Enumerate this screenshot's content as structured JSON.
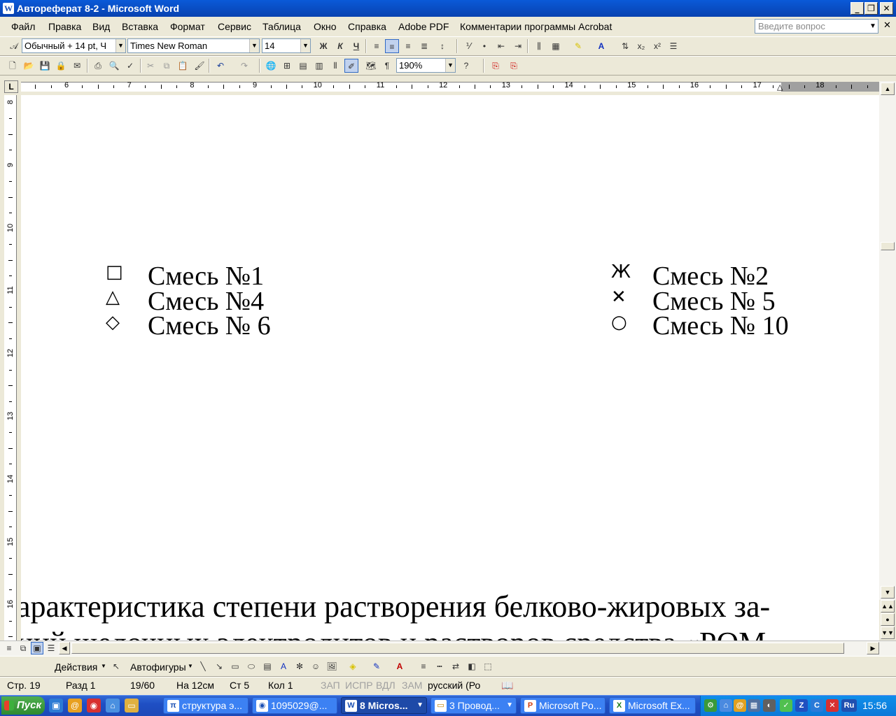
{
  "window": {
    "title": "Автореферат 8-2 - Microsoft Word",
    "app_icon": "W",
    "buttons": [
      "_",
      "❐",
      "✕"
    ]
  },
  "menu": {
    "items": [
      "Файл",
      "Правка",
      "Вид",
      "Вставка",
      "Формат",
      "Сервис",
      "Таблица",
      "Окно",
      "Справка",
      "Adobe PDF",
      "Комментарии программы Acrobat"
    ],
    "question_placeholder": "Введите вопрос"
  },
  "format_toolbar": {
    "style": "Обычный + 14 pt, Ч",
    "font": "Times New Roman",
    "size": "14",
    "bold": "Ж",
    "italic": "К",
    "underline": "Ч"
  },
  "standard_toolbar": {
    "zoom": "190%"
  },
  "ruler": {
    "h_numbers": [
      "6",
      "7",
      "8",
      "9",
      "10",
      "11",
      "12",
      "13",
      "14",
      "15",
      "16",
      "17",
      "18"
    ],
    "v_numbers": [
      "8",
      "9",
      "10",
      "11",
      "12",
      "13",
      "14",
      "15",
      "16"
    ]
  },
  "document": {
    "legend_left": [
      {
        "symbol": "□",
        "label": "Смесь №1"
      },
      {
        "symbol": "△",
        "label": "Смесь №4"
      },
      {
        "symbol": "◇",
        "label": "Смесь № 6"
      }
    ],
    "legend_right": [
      {
        "symbol": "Ж",
        "label": "Смесь №2"
      },
      {
        "symbol": "✕",
        "label": "Смесь № 5"
      },
      {
        "symbol": "○",
        "label": "Смесь № 10"
      }
    ],
    "line1": "арактеристика степени растворения белково-жировых за-",
    "line2": "ний щелочных электролитов и растворов средства «POM"
  },
  "draw_toolbar": {
    "actions": "Действия",
    "autoshapes": "Автофигуры"
  },
  "status": {
    "page": "Стр. 19",
    "section": "Разд 1",
    "pages": "19/60",
    "at": "На 12см",
    "line": "Ст 5",
    "col": "Кол 1",
    "rec": "ЗАП",
    "trk": "ИСПР",
    "ext": "ВДЛ",
    "ovr": "ЗАМ",
    "language": "русский (Ро"
  },
  "taskbar": {
    "start": "Пуск",
    "tasks": [
      {
        "label": "структура э...",
        "icon": "π"
      },
      {
        "label": "1095029@...",
        "icon": "◉"
      },
      {
        "label": "8 Micros...",
        "icon": "W"
      },
      {
        "label": "3 Провод...",
        "icon": "▭"
      },
      {
        "label": "Microsoft Po...",
        "icon": "P"
      },
      {
        "label": "Microsoft Ex...",
        "icon": "X"
      }
    ],
    "clock": "15:56",
    "lang": "Ru"
  }
}
